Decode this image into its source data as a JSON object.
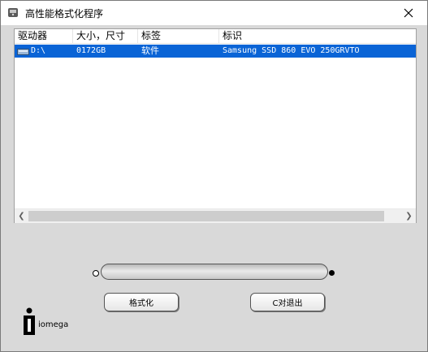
{
  "window": {
    "title": "高性能格式化程序"
  },
  "columns": [
    "驱动器",
    "大小，尺寸",
    "标签",
    "标识"
  ],
  "rows": [
    {
      "drive": "D:\\",
      "size": "0172GB",
      "label": "软件",
      "id": "Samsung SSD 860 EVO 250GRVTO"
    }
  ],
  "progress": {
    "value": 0
  },
  "buttons": {
    "format": "格式化",
    "exit": "C对退出"
  },
  "logo": {
    "text": "iomega"
  }
}
